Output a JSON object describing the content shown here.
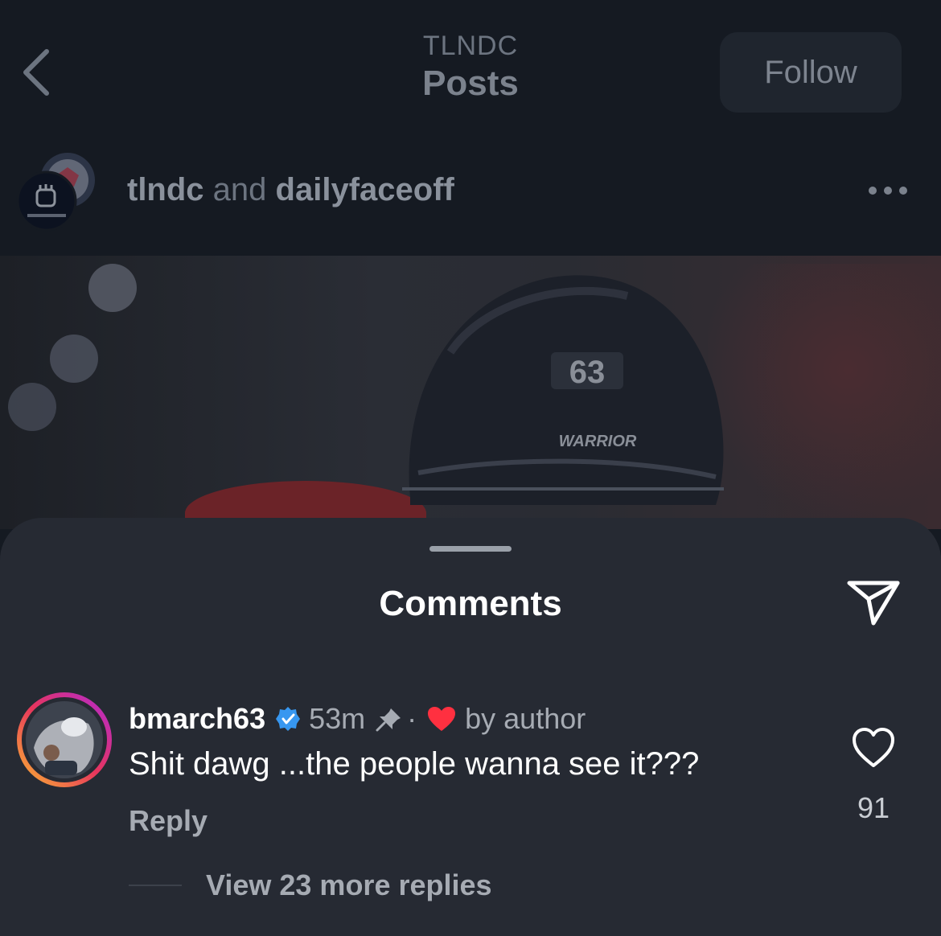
{
  "header": {
    "account": "TLNDC",
    "title": "Posts",
    "follow_label": "Follow"
  },
  "post": {
    "author_primary": "tlndc",
    "author_connector": "and",
    "author_secondary": "dailyfaceoff",
    "photo_helmet_number": "63",
    "photo_helmet_brand": "WARRIOR"
  },
  "comments_sheet": {
    "title": "Comments",
    "comment": {
      "username": "bmarch63",
      "time": "53m",
      "separator": "·",
      "liked_by_label": "by author",
      "text": "Shit dawg ...the people wanna see it???",
      "reply_label": "Reply",
      "like_count": "91"
    },
    "view_replies_label": "View 23 more replies"
  },
  "colors": {
    "sheet_bg": "#262a33",
    "page_bg": "#151a22",
    "verified_blue": "#3797f0",
    "heart_red": "#ff3040"
  }
}
